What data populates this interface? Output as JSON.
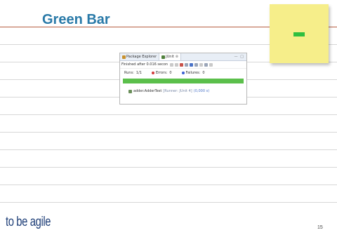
{
  "slide": {
    "title": "Green Bar",
    "page_number": "15",
    "logo_text": "to be agile",
    "colors": {
      "title": "#2a7aa8",
      "note": "#f6ee8a",
      "note_mark": "#2fbf3f",
      "rule_accent": "#b45a3c",
      "green_bar": "#5bbf4b"
    }
  },
  "junit": {
    "tab_package": "Package Explorer",
    "tab_junit": "JUnit",
    "tab_close": "⊗",
    "window_controls": "— □",
    "status": "Finished after 0.016 secon",
    "runs_label": "Runs:",
    "runs_value": "1/1",
    "errors_label": "Errors:",
    "errors_value": "0",
    "failures_label": "Failures:",
    "failures_value": "0",
    "progress_fraction": 1.0,
    "test_name": "adder.AdderTest",
    "test_runner": "[Runner: JUnit 4]",
    "test_time": "(0,000 s)"
  }
}
